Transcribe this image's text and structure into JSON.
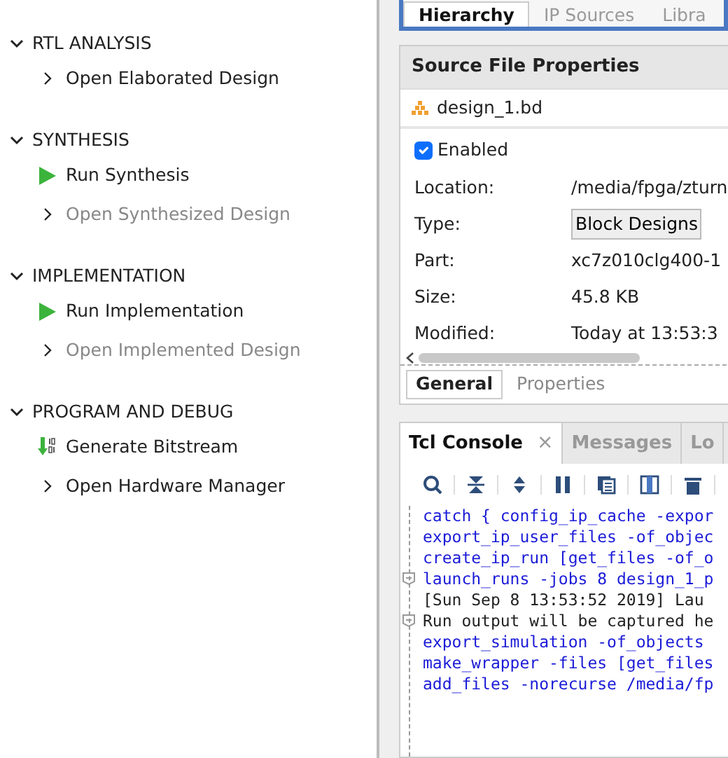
{
  "flow_navigator": [
    {
      "title": "RTL ANALYSIS",
      "expanded": true,
      "items": [
        {
          "label": "Open Elaborated Design",
          "kind": "expand",
          "disabled": false
        }
      ]
    },
    {
      "title": "SYNTHESIS",
      "expanded": true,
      "items": [
        {
          "label": "Run Synthesis",
          "kind": "run",
          "disabled": false
        },
        {
          "label": "Open Synthesized Design",
          "kind": "expand",
          "disabled": true
        }
      ]
    },
    {
      "title": "IMPLEMENTATION",
      "expanded": true,
      "items": [
        {
          "label": "Run Implementation",
          "kind": "run",
          "disabled": false
        },
        {
          "label": "Open Implemented Design",
          "kind": "expand",
          "disabled": true
        }
      ]
    },
    {
      "title": "PROGRAM AND DEBUG",
      "expanded": true,
      "items": [
        {
          "label": "Generate Bitstream",
          "kind": "bitstream",
          "disabled": false
        },
        {
          "label": "Open Hardware Manager",
          "kind": "expand",
          "disabled": false
        }
      ]
    }
  ],
  "source_tabs": [
    {
      "label": "Hierarchy",
      "selected": true
    },
    {
      "label": "IP Sources",
      "selected": false
    },
    {
      "label": "Libra",
      "selected": false
    }
  ],
  "properties": {
    "title": "Source File Properties",
    "file": "design_1.bd",
    "enabled": {
      "label": "Enabled",
      "checked": true
    },
    "rows": [
      {
        "label": "Location:",
        "value": "/media/fpga/zturn",
        "kind": "text"
      },
      {
        "label": "Type:",
        "value": "Block Designs",
        "kind": "button"
      },
      {
        "label": "Part:",
        "value": "xc7z010clg400-1",
        "kind": "text"
      },
      {
        "label": "Size:",
        "value": "45.8 KB",
        "kind": "text"
      },
      {
        "label": "Modified:",
        "value": "Today at 13:53:3",
        "kind": "text"
      }
    ],
    "tabs": [
      {
        "label": "General",
        "selected": true
      },
      {
        "label": "Properties",
        "selected": false
      }
    ]
  },
  "console": {
    "tabs": [
      {
        "label": "Tcl Console",
        "selected": true,
        "close": "×"
      },
      {
        "label": "Messages",
        "selected": false
      },
      {
        "label": "Lo",
        "selected": false
      }
    ],
    "lines": [
      {
        "text": "catch { config_ip_cache -expor",
        "kind": "command",
        "fold": false
      },
      {
        "text": "export_ip_user_files -of_objec",
        "kind": "command",
        "fold": false
      },
      {
        "text": "create_ip_run [get_files -of_o",
        "kind": "command",
        "fold": false
      },
      {
        "text": "launch_runs -jobs 8 design_1_p",
        "kind": "command",
        "fold": true
      },
      {
        "text": "[Sun Sep  8 13:53:52 2019] Lau",
        "kind": "output",
        "fold": false
      },
      {
        "text": "Run output will be captured he",
        "kind": "output",
        "fold": true
      },
      {
        "text": "export_simulation -of_objects",
        "kind": "command",
        "fold": false
      },
      {
        "text": "make_wrapper -files [get_files",
        "kind": "command",
        "fold": false
      },
      {
        "text": "add_files -norecurse /media/fp",
        "kind": "command",
        "fold": false
      }
    ]
  }
}
